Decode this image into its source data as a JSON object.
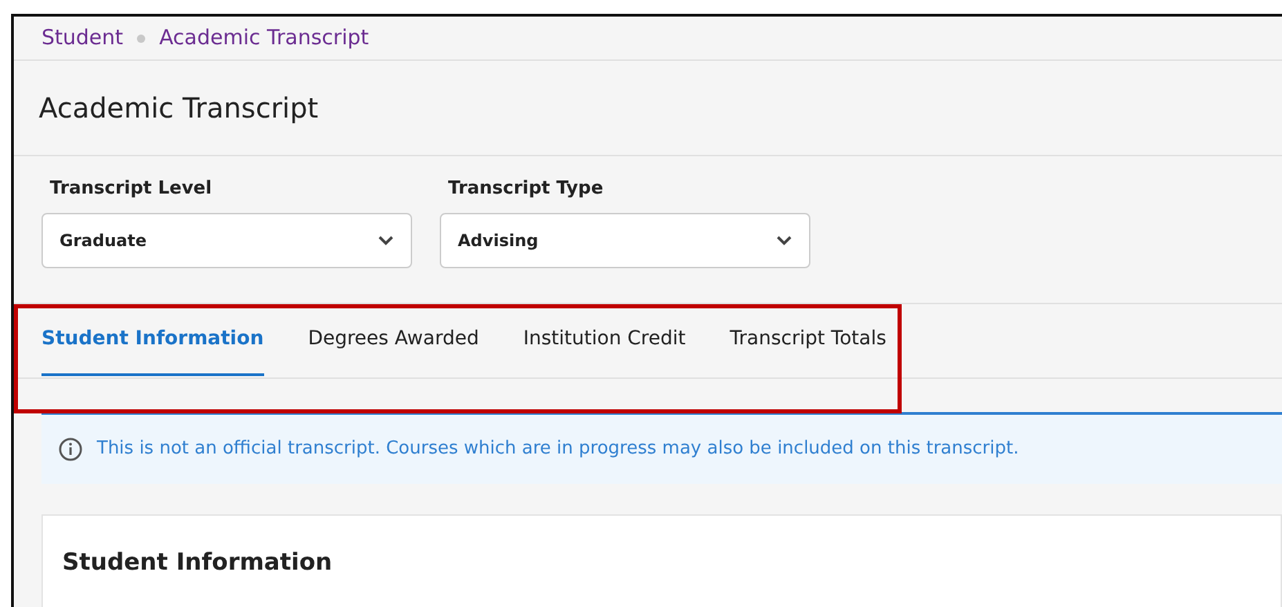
{
  "breadcrumb": [
    "Student",
    "Academic Transcript"
  ],
  "title": "Academic Transcript",
  "filters": [
    {
      "label": "Transcript Level",
      "value": "Graduate"
    },
    {
      "label": "Transcript Type",
      "value": "Advising"
    }
  ],
  "tabs": [
    {
      "label": "Student Information",
      "selected": true
    },
    {
      "label": "Degrees Awarded",
      "selected": false
    },
    {
      "label": "Institution Credit",
      "selected": false
    },
    {
      "label": "Transcript Totals",
      "selected": false
    }
  ],
  "notice": "This is not an official transcript. Courses which are in progress may also be included on this transcript.",
  "section": {
    "heading": "Student Information"
  }
}
